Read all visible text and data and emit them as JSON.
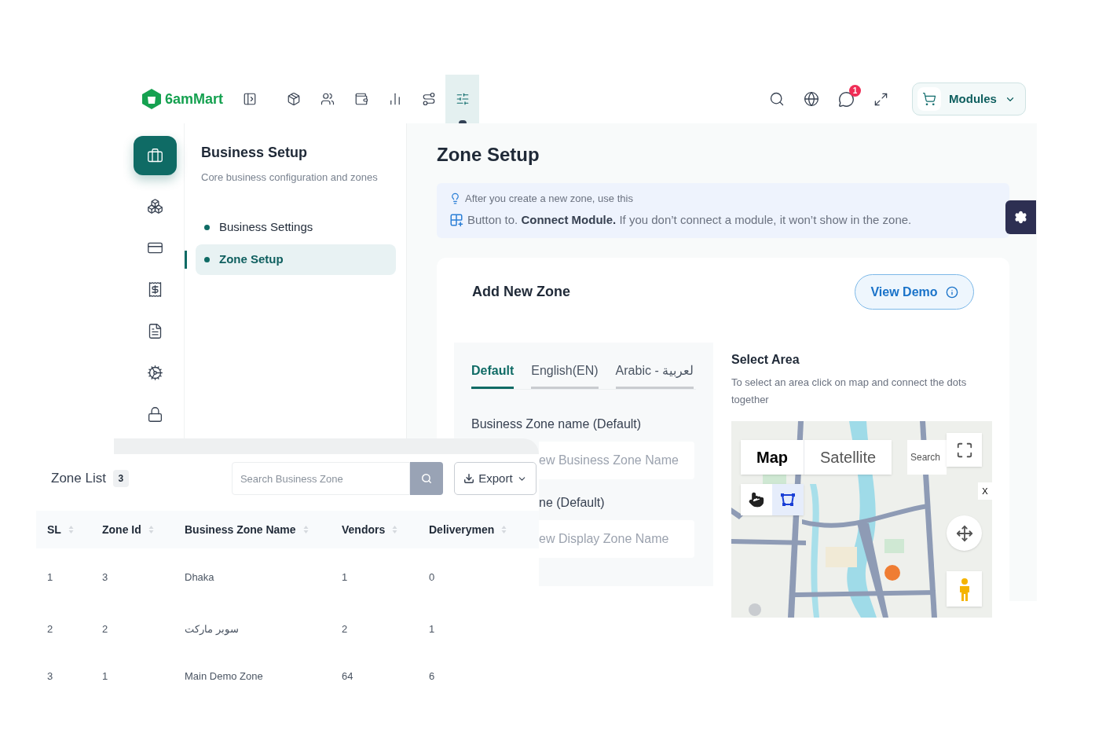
{
  "brand": {
    "name": "6amMart"
  },
  "top_nav": [
    {
      "kind": "sidebar",
      "selected": false
    },
    {
      "kind": "box",
      "selected": false
    },
    {
      "kind": "users",
      "selected": false
    },
    {
      "kind": "wallet",
      "selected": false
    },
    {
      "kind": "chart",
      "selected": false
    },
    {
      "kind": "route",
      "selected": false
    },
    {
      "kind": "sliders",
      "selected": true
    }
  ],
  "header_actions": {
    "notification_count": "1",
    "modules_button": "Modules"
  },
  "rail": [
    {
      "kind": "briefcase",
      "selected": true
    },
    {
      "kind": "boxes",
      "selected": false
    },
    {
      "kind": "card",
      "selected": false
    },
    {
      "kind": "receipt",
      "selected": false
    },
    {
      "kind": "file",
      "selected": false
    },
    {
      "kind": "cog",
      "selected": false
    },
    {
      "kind": "lock",
      "selected": false
    }
  ],
  "section": {
    "title": "Business Setup",
    "subtitle": "Core business configuration and zones",
    "items": [
      {
        "label": "Business Settings",
        "selected": false
      },
      {
        "label": "Zone Setup",
        "selected": true
      }
    ]
  },
  "page_title": "Zone Setup",
  "info": {
    "line_1": "After you create a new zone, use this",
    "line_2": "Button to. **Connect Module.** If you don’t connect a module, it won’t show in the zone."
  },
  "add_zone": {
    "title": "Add New Zone",
    "demo_button": "View Demo",
    "language_tabs": [
      {
        "label": "Default",
        "selected": true
      },
      {
        "label": "English(EN)",
        "selected": false
      },
      {
        "label": "Arabic - لعربية",
        "selected": false
      }
    ],
    "fields": [
      {
        "label": "Business Zone name (Default)",
        "placeholder": "ew Business Zone Name"
      },
      {
        "label": "ne (Default)",
        "placeholder": "ew Display Zone Name"
      }
    ],
    "select_area": {
      "title": "Select Area",
      "hint": "To select an area click on map and connect the dots together"
    },
    "map": {
      "map_types": [
        {
          "label": "Map",
          "selected": true
        },
        {
          "label": "Satellite",
          "selected": false
        }
      ],
      "search_placeholder": "Search",
      "close": "X",
      "draw_tools": [
        {
          "kind": "hand",
          "selected": false
        },
        {
          "kind": "polygon",
          "selected": true
        }
      ]
    }
  },
  "zone_list": {
    "title": "Zone List",
    "count": "3",
    "search_placeholder": "Search Business Zone",
    "export_button": "Export",
    "columns": [
      "SL",
      "Zone Id",
      "Business Zone Name",
      "Vendors",
      "Deliverymen"
    ],
    "rows": [
      [
        "1",
        "3",
        "Dhaka",
        "1",
        "0"
      ],
      [
        "2",
        "2",
        "سوبر ماركت",
        "2",
        "1"
      ],
      [
        "3",
        "1",
        "Main Demo Zone",
        "64",
        "6"
      ]
    ]
  }
}
